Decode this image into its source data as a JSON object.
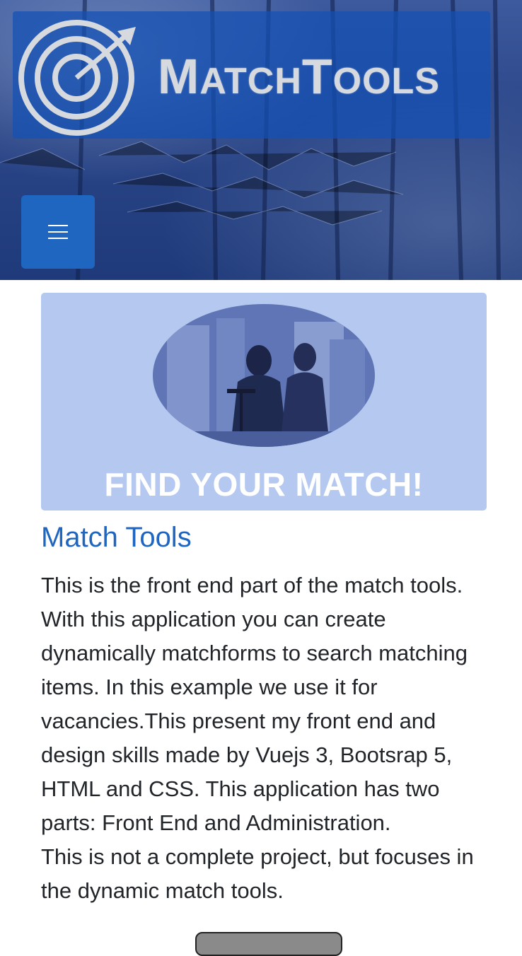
{
  "header": {
    "logo": {
      "brand_text_first_initial": "M",
      "brand_text_first_rest": "ATCH",
      "brand_text_second_initial": "T",
      "brand_text_second_rest": "OOLS",
      "brand_name": "MatchTools",
      "icon": "target-arrow-icon"
    },
    "menu_button": {
      "icon": "hamburger-menu-icon"
    }
  },
  "hero": {
    "image": "meeting-room-photo",
    "title": "FIND YOUR MATCH!"
  },
  "main": {
    "title": "Match Tools",
    "paragraph_1": "This is the front end part of the match tools. With this application you can create dynamically matchforms to search matching items. In this example we use it for vacancies.This present my front end and design skills made by Vuejs 3, Bootsrap 5, HTML and CSS. This application has two parts: Front End and Administration.",
    "paragraph_2": "This is not a complete project, but focuses in the dynamic match tools."
  },
  "colors": {
    "primary": "#1f66c1",
    "hero_bg": "#b5c9f0",
    "text": "#212529",
    "logo_bar": "#1450b4"
  }
}
